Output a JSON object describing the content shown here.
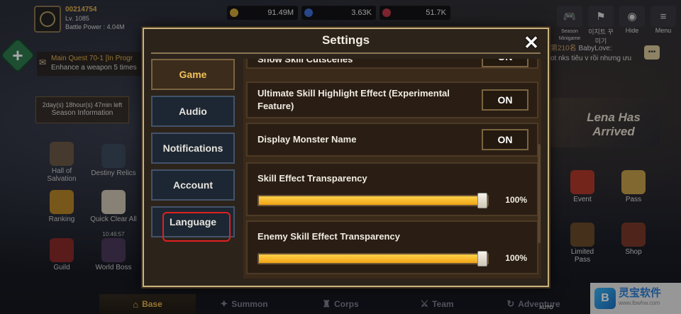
{
  "profile": {
    "uid": "00214754",
    "level": "Lv. 1085",
    "battle_power": "Battle Power : 4.04M"
  },
  "quest": {
    "title": "Main Quest 70-1 [In Progr",
    "desc": "Enhance a weapon 5 times"
  },
  "season": {
    "timer": "2day(s) 18hour(s) 47min left",
    "label": "Season Information"
  },
  "left_menu": {
    "hall": "Hall of Salvation",
    "destiny": "Destiny Relics",
    "ranking": "Ranking",
    "quick_clear": "Quick Clear All",
    "quick_time": "10:46:57",
    "guild": "Guild",
    "world_boss": "World Boss"
  },
  "resources": {
    "gold": "91.49M",
    "gem": "3.63K",
    "ruby": "51.7K"
  },
  "top_right": {
    "season_minigame": "Season Minigame",
    "event_btn": "이지트 꾸미기",
    "hide": "Hide",
    "menu": "Menu"
  },
  "chat": {
    "prefix": "第210名",
    "name": "BabyLove:",
    "msg": "ot nks tiêu v rồi nhưng ưu"
  },
  "banner": {
    "text": "Lena Has Arrived"
  },
  "right_menu": {
    "event": "Event",
    "pass": "Pass",
    "limited_pass": "Limited Pass",
    "shop": "Shop"
  },
  "bottom_nav": {
    "base": "Base",
    "summon": "Summon",
    "corps": "Corps",
    "team": "Team",
    "adventure": "Adventure",
    "auto": "AUTO"
  },
  "watermark": {
    "name": "灵宝软件",
    "url": "www.lbwhw.com"
  },
  "settings": {
    "title": "Settings",
    "close_icon": "✕",
    "tabs": [
      "Game",
      "Audio",
      "Notifications",
      "Account",
      "Language"
    ],
    "active_tab": "Game",
    "partial_row": {
      "label": "Show Skill Cutscenes",
      "value": "ON"
    },
    "rows": [
      {
        "label": "Ultimate Skill Highlight Effect (Experimental Feature)",
        "value": "ON"
      },
      {
        "label": "Display Monster Name",
        "value": "ON"
      }
    ],
    "sliders": [
      {
        "label": "Skill Effect Transparency",
        "value_text": "100%",
        "value": 1.0
      },
      {
        "label": "Enemy Skill Effect Transparency",
        "value_text": "100%",
        "value": 1.0
      }
    ]
  },
  "colors": {
    "accent_gold": "#e9b64e",
    "highlight_red": "#e02020",
    "slider_fill": "#f0a416"
  }
}
